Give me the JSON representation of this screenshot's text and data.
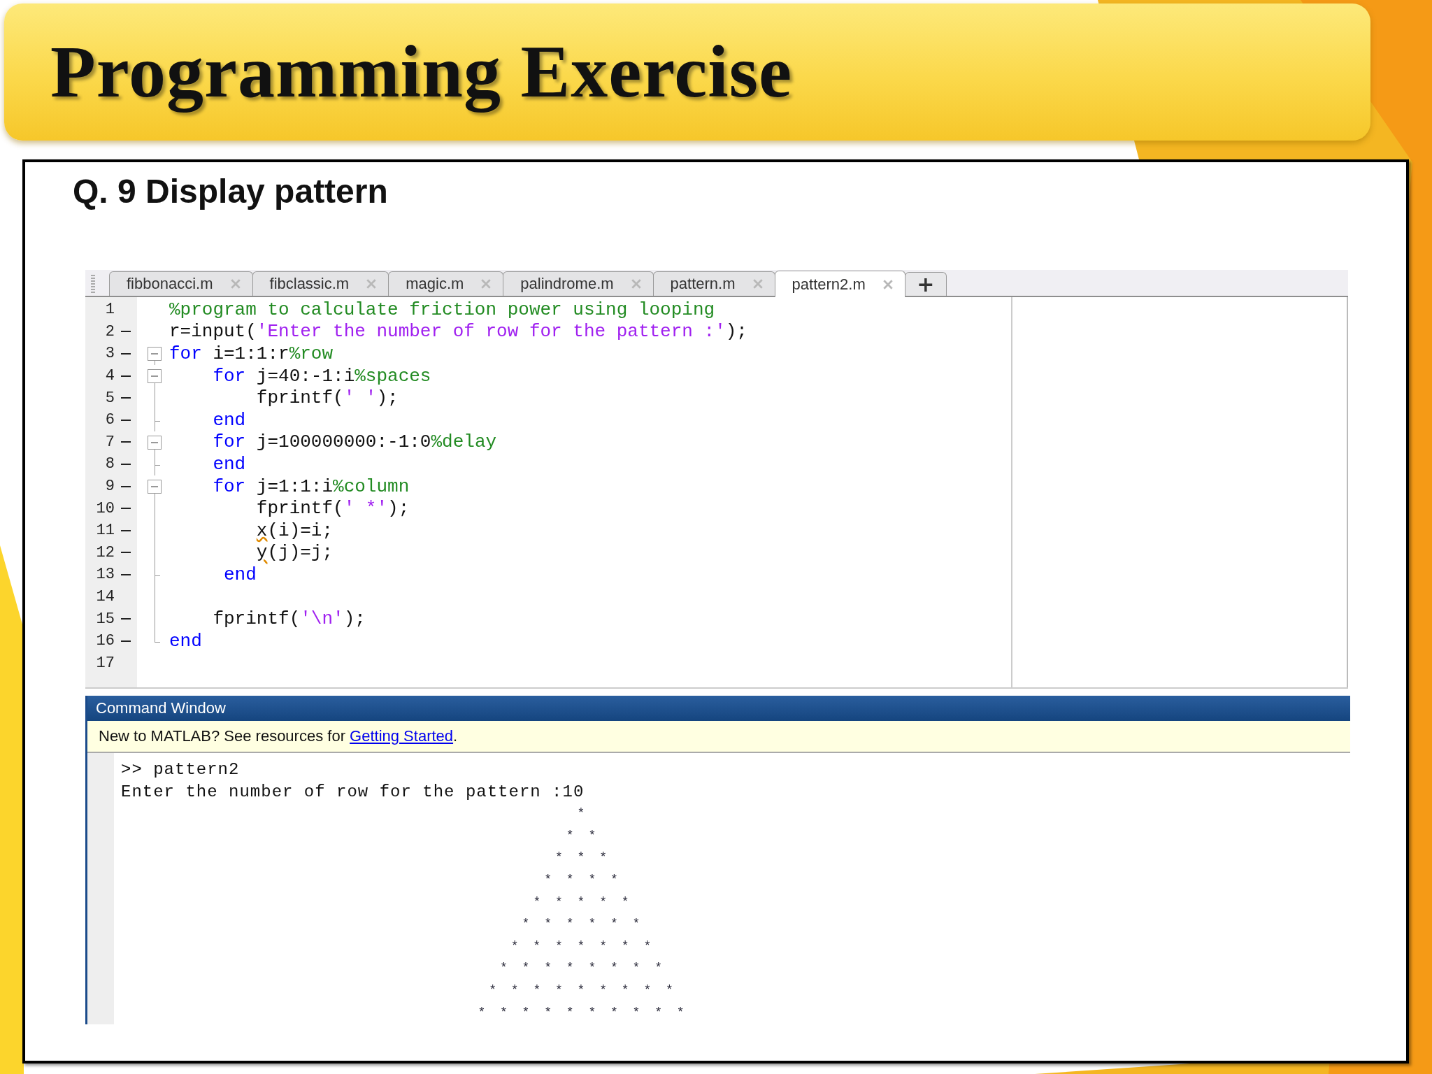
{
  "slide_title": "Programming Exercise",
  "question": "Q. 9 Display pattern",
  "editor": {
    "tabs": [
      {
        "label": "fibbonacci.m",
        "selected": false
      },
      {
        "label": "fibclassic.m",
        "selected": false
      },
      {
        "label": "magic.m",
        "selected": false
      },
      {
        "label": "palindrome.m",
        "selected": false
      },
      {
        "label": "pattern.m",
        "selected": false
      },
      {
        "label": "pattern2.m",
        "selected": true
      }
    ],
    "new_tab": "+",
    "lines": [
      {
        "number": "1",
        "marker": false,
        "kind": "plain",
        "tokens": [
          {
            "kind": "cm",
            "text": "%program to calculate friction power using looping"
          }
        ]
      },
      {
        "number": "2",
        "marker": true,
        "kind": "plain",
        "tokens": [
          {
            "kind": "tx",
            "text": "r=input("
          },
          {
            "kind": "str",
            "text": "'Enter the number of row for the pattern :'"
          },
          {
            "kind": "tx",
            "text": ");"
          }
        ]
      },
      {
        "number": "3",
        "marker": true,
        "kind": "box",
        "tokens": [
          {
            "kind": "kw",
            "text": "for"
          },
          {
            "kind": "tx",
            "text": " i=1:1:r"
          },
          {
            "kind": "cm",
            "text": "%row"
          }
        ]
      },
      {
        "number": "4",
        "marker": true,
        "kind": "box",
        "tokens": [
          {
            "kind": "kw",
            "text": "    for"
          },
          {
            "kind": "tx",
            "text": " j=40:-1:i"
          },
          {
            "kind": "cm",
            "text": "%spaces"
          }
        ]
      },
      {
        "number": "5",
        "marker": true,
        "kind": "bar",
        "tokens": [
          {
            "kind": "tx",
            "text": "        fprintf("
          },
          {
            "kind": "str",
            "text": "' '"
          },
          {
            "kind": "tx",
            "text": ");"
          }
        ]
      },
      {
        "number": "6",
        "marker": true,
        "kind": "tick",
        "tokens": [
          {
            "kind": "kw",
            "text": "    end"
          }
        ]
      },
      {
        "number": "7",
        "marker": true,
        "kind": "box",
        "tokens": [
          {
            "kind": "kw",
            "text": "    for"
          },
          {
            "kind": "tx",
            "text": " j=100000000:-1:0"
          },
          {
            "kind": "cm",
            "text": "%delay"
          }
        ]
      },
      {
        "number": "8",
        "marker": true,
        "kind": "tick",
        "tokens": [
          {
            "kind": "kw",
            "text": "    end"
          }
        ]
      },
      {
        "number": "9",
        "marker": true,
        "kind": "box",
        "tokens": [
          {
            "kind": "kw",
            "text": "    for"
          },
          {
            "kind": "tx",
            "text": " j=1:1:i"
          },
          {
            "kind": "cm",
            "text": "%column"
          }
        ]
      },
      {
        "number": "10",
        "marker": true,
        "kind": "bar",
        "tokens": [
          {
            "kind": "tx",
            "text": "        fprintf("
          },
          {
            "kind": "str",
            "text": "' *'"
          },
          {
            "kind": "tx",
            "text": ");"
          }
        ]
      },
      {
        "number": "11",
        "marker": true,
        "kind": "bar",
        "tokens": [
          {
            "kind": "warn",
            "text": "        x"
          },
          {
            "kind": "tx",
            "text": "(i)=i;"
          }
        ]
      },
      {
        "number": "12",
        "marker": true,
        "kind": "bar",
        "tokens": [
          {
            "kind": "warn",
            "text": "        y"
          },
          {
            "kind": "tx",
            "text": "(j)=j;"
          }
        ]
      },
      {
        "number": "13",
        "marker": true,
        "kind": "tick",
        "tokens": [
          {
            "kind": "kw",
            "text": "     end"
          }
        ]
      },
      {
        "number": "14",
        "marker": false,
        "kind": "bar"
      },
      {
        "number": "15",
        "marker": true,
        "kind": "bar",
        "tokens": [
          {
            "kind": "tx",
            "text": "    fprintf("
          },
          {
            "kind": "str",
            "text": "'\\n'"
          },
          {
            "kind": "tx",
            "text": ");"
          }
        ]
      },
      {
        "number": "16",
        "marker": true,
        "kind": "corner",
        "tokens": [
          {
            "kind": "kw",
            "text": "end"
          }
        ]
      },
      {
        "number": "17",
        "marker": false,
        "kind": "plain"
      }
    ]
  },
  "command_window": {
    "title": "Command Window",
    "notice": {
      "text": "New to MATLAB? See resources for ",
      "link": "Getting Started",
      "after": "."
    },
    "lines": [
      {
        "kind": "text",
        "text": ">> pattern2"
      },
      {
        "kind": "text",
        "text": "Enter the number of row for the pattern :10"
      },
      {
        "kind": "pattern",
        "text": "*\n* *\n* * *\n* * * *\n* * * * *\n* * * * * *\n* * * * * * *\n* * * * * * * *\n* * * * * * * * *\n* * * * * * * * * *"
      }
    ]
  }
}
